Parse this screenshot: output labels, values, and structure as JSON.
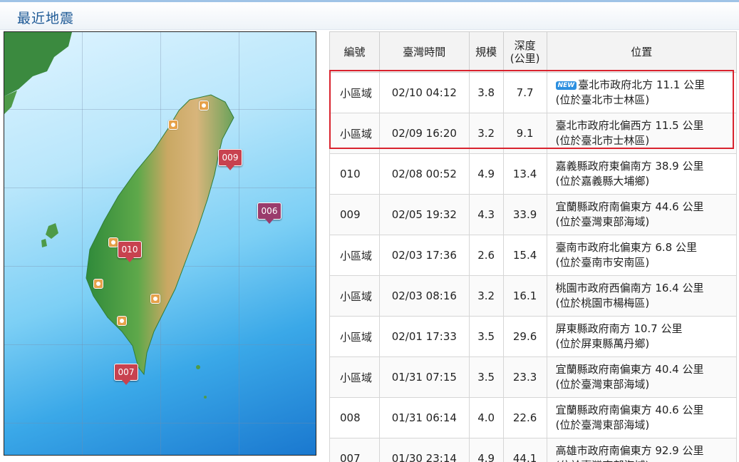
{
  "page": {
    "title": "最近地震"
  },
  "map": {
    "markers": [
      {
        "label": "009",
        "color": "#c8424f"
      },
      {
        "label": "006",
        "color": "#9a3b6c"
      },
      {
        "label": "010",
        "color": "#c8424f"
      },
      {
        "label": "007",
        "color": "#c8424f"
      }
    ]
  },
  "table": {
    "headers": [
      "編號",
      "臺灣時間",
      "規模",
      "深度\n(公里)",
      "位置"
    ],
    "new_badge": "NEW",
    "rows": [
      {
        "id": "小區域",
        "time": "02/10 04:12",
        "mag": "3.8",
        "depth": "7.7",
        "loc1": "臺北市政府北方 11.1 公里",
        "loc2": "(位於臺北市士林區)",
        "is_new": true
      },
      {
        "id": "小區域",
        "time": "02/09 16:20",
        "mag": "3.2",
        "depth": "9.1",
        "loc1": "臺北市政府北偏西方 11.5 公里",
        "loc2": "(位於臺北市士林區)"
      },
      {
        "id": "010",
        "time": "02/08 00:52",
        "mag": "4.9",
        "depth": "13.4",
        "loc1": "嘉義縣政府東偏南方 38.9 公里",
        "loc2": "(位於嘉義縣大埔鄉)"
      },
      {
        "id": "009",
        "time": "02/05 19:32",
        "mag": "4.3",
        "depth": "33.9",
        "loc1": "宜蘭縣政府南偏東方 44.6 公里",
        "loc2": "(位於臺灣東部海域)"
      },
      {
        "id": "小區域",
        "time": "02/03 17:36",
        "mag": "2.6",
        "depth": "15.4",
        "loc1": "臺南市政府北偏東方 6.8 公里",
        "loc2": "(位於臺南市安南區)"
      },
      {
        "id": "小區域",
        "time": "02/03 08:16",
        "mag": "3.2",
        "depth": "16.1",
        "loc1": "桃園市政府西偏南方 16.4 公里",
        "loc2": "(位於桃園市楊梅區)"
      },
      {
        "id": "小區域",
        "time": "02/01 17:33",
        "mag": "3.5",
        "depth": "29.6",
        "loc1": "屏東縣政府南方 10.7 公里",
        "loc2": "(位於屏東縣萬丹鄉)"
      },
      {
        "id": "小區域",
        "time": "01/31 07:15",
        "mag": "3.5",
        "depth": "23.3",
        "loc1": "宜蘭縣政府南偏東方 40.4 公里",
        "loc2": "(位於臺灣東部海域)"
      },
      {
        "id": "008",
        "time": "01/31 06:14",
        "mag": "4.0",
        "depth": "22.6",
        "loc1": "宜蘭縣政府南偏東方 40.6 公里",
        "loc2": "(位於臺灣東部海域)"
      },
      {
        "id": "007",
        "time": "01/30 23:14",
        "mag": "4.9",
        "depth": "44.1",
        "loc1": "高雄市政府南偏東方 92.9 公里",
        "loc2": "(位於臺灣南部海域)"
      }
    ]
  }
}
